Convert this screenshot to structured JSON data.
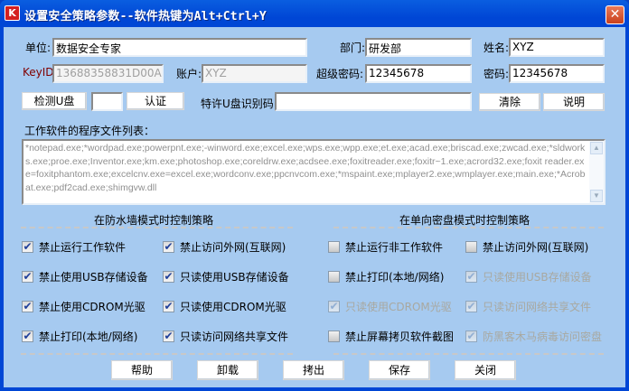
{
  "title": "设置安全策略参数--软件热键为Alt+Ctrl+Y",
  "icons": {
    "app": "app-logo-icon",
    "close": "close-icon",
    "check": "checkmark-icon"
  },
  "colors": {
    "titlebar": "#0046d5",
    "client": "#a6caf0",
    "keyid_label": "#800000"
  },
  "fields": {
    "unit": {
      "label": "单位:",
      "value": "数据安全专家"
    },
    "dept": {
      "label": "部门:",
      "value": "研发部"
    },
    "name": {
      "label": "姓名:",
      "value": "XYZ"
    },
    "keyid": {
      "label": "KeyID:",
      "value": "13688358831D00A"
    },
    "account": {
      "label": "账户:",
      "value": "XYZ"
    },
    "super_pwd": {
      "label": "超级密码:",
      "value": "12345678"
    },
    "pwd": {
      "label": "密码:",
      "value": "12345678"
    },
    "usb_small": {
      "value": ""
    },
    "special_usb": {
      "label": "特许U盘识别码:",
      "value": ""
    }
  },
  "buttons": {
    "detect": "检测U盘",
    "auth": "认证",
    "clear": "清除",
    "explain": "说明",
    "help": "帮助",
    "uninstall": "卸载",
    "export": "拷出",
    "save": "保存",
    "close": "关闭"
  },
  "program_list": {
    "label": "工作软件的程序文件列表：",
    "value": "*notepad.exe;*wordpad.exe;powerpnt.exe;-winword.exe;excel.exe;wps.exe;wpp.exe;et.exe;acad.exe;briscad.exe;zwcad.exe;*sldworks.exe;proe.exe;Inventor.exe;km.exe;photoshop.exe;coreldrw.exe;acdsee.exe;foxitreader.exe;foxitr~1.exe;acrord32.exe;foxit reader.exe=foxitphantom.exe;excelcnv.exe=excel.exe;wordconv.exe;ppcnvcom.exe;*mspaint.exe;mplayer2.exe;wmplayer.exe;main.exe;*Acrobat.exe;pdf2cad.exe;shimgvw.dll"
  },
  "firewall": {
    "title": "在防水墙模式时控制策略",
    "items": [
      {
        "label": "禁止运行工作软件",
        "checked": true,
        "enabled": true
      },
      {
        "label": "禁止访问外网(互联网)",
        "checked": true,
        "enabled": true
      },
      {
        "label": "禁止使用USB存储设备",
        "checked": true,
        "enabled": true
      },
      {
        "label": "只读使用USB存储设备",
        "checked": true,
        "enabled": true
      },
      {
        "label": "禁止使用CDROM光驱",
        "checked": true,
        "enabled": true
      },
      {
        "label": "只读使用CDROM光驱",
        "checked": true,
        "enabled": true
      },
      {
        "label": "禁止打印(本地/网络)",
        "checked": true,
        "enabled": true
      },
      {
        "label": "只读访问网络共享文件",
        "checked": true,
        "enabled": true
      }
    ]
  },
  "oneway": {
    "title": "在单向密盘模式时控制策略",
    "items": [
      {
        "label": "禁止运行非工作软件",
        "checked": false,
        "enabled": true
      },
      {
        "label": "禁止访问外网(互联网)",
        "checked": false,
        "enabled": true
      },
      {
        "label": "禁止打印(本地/网络)",
        "checked": false,
        "enabled": true
      },
      {
        "label": "只读使用USB存储设备",
        "checked": true,
        "enabled": false
      },
      {
        "label": "只读使用CDROM光驱",
        "checked": true,
        "enabled": false
      },
      {
        "label": "只读访问网络共享文件",
        "checked": true,
        "enabled": false
      },
      {
        "label": "禁止屏幕拷贝软件截图",
        "checked": false,
        "enabled": true
      },
      {
        "label": "防黑客木马病毒访问密盘",
        "checked": true,
        "enabled": false
      }
    ]
  }
}
